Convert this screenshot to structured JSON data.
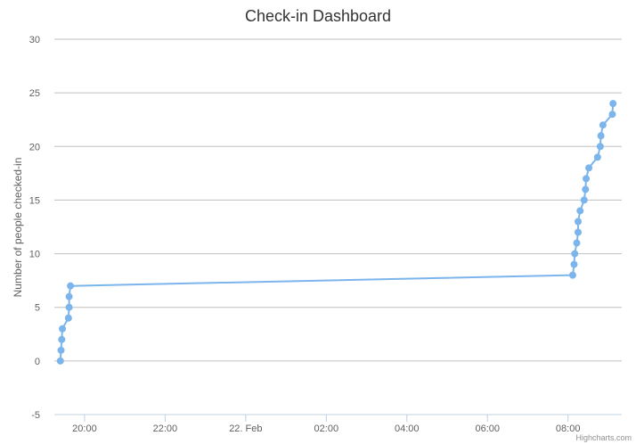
{
  "chart_data": {
    "type": "line",
    "title": "Check-in Dashboard",
    "xlabel": "",
    "ylabel": "Number of people checked-in",
    "x_type": "datetime",
    "xlim": [
      "2020-02-21T19:15",
      "2020-02-22T09:20"
    ],
    "ylim": [
      -5,
      30
    ],
    "y_ticks": [
      -5,
      0,
      5,
      10,
      15,
      20,
      25,
      30
    ],
    "x_ticks": [
      {
        "t": "2020-02-21T20:00",
        "label": "20:00"
      },
      {
        "t": "2020-02-21T22:00",
        "label": "22:00"
      },
      {
        "t": "2020-02-22T00:00",
        "label": "22. Feb"
      },
      {
        "t": "2020-02-22T02:00",
        "label": "02:00"
      },
      {
        "t": "2020-02-22T04:00",
        "label": "04:00"
      },
      {
        "t": "2020-02-22T06:00",
        "label": "06:00"
      },
      {
        "t": "2020-02-22T08:00",
        "label": "08:00"
      }
    ],
    "grid": true,
    "legend": false,
    "series_color": "#7cb5ec",
    "grid_color": "#c0c0c0",
    "series": [
      {
        "points": [
          {
            "x": "2020-02-21T19:24",
            "y": 0
          },
          {
            "x": "2020-02-21T19:25",
            "y": 1
          },
          {
            "x": "2020-02-21T19:26",
            "y": 2
          },
          {
            "x": "2020-02-21T19:27",
            "y": 3
          },
          {
            "x": "2020-02-21T19:36",
            "y": 4
          },
          {
            "x": "2020-02-21T19:37",
            "y": 5
          },
          {
            "x": "2020-02-21T19:37",
            "y": 6
          },
          {
            "x": "2020-02-21T19:39",
            "y": 7
          },
          {
            "x": "2020-02-22T08:07",
            "y": 8
          },
          {
            "x": "2020-02-22T08:09",
            "y": 9
          },
          {
            "x": "2020-02-22T08:10",
            "y": 10
          },
          {
            "x": "2020-02-22T08:13",
            "y": 11
          },
          {
            "x": "2020-02-22T08:15",
            "y": 12
          },
          {
            "x": "2020-02-22T08:15",
            "y": 13
          },
          {
            "x": "2020-02-22T08:18",
            "y": 14
          },
          {
            "x": "2020-02-22T08:24",
            "y": 15
          },
          {
            "x": "2020-02-22T08:26",
            "y": 16
          },
          {
            "x": "2020-02-22T08:27",
            "y": 17
          },
          {
            "x": "2020-02-22T08:31",
            "y": 18
          },
          {
            "x": "2020-02-22T08:44",
            "y": 19
          },
          {
            "x": "2020-02-22T08:48",
            "y": 20
          },
          {
            "x": "2020-02-22T08:49",
            "y": 21
          },
          {
            "x": "2020-02-22T08:52",
            "y": 22
          },
          {
            "x": "2020-02-22T09:06",
            "y": 23
          },
          {
            "x": "2020-02-22T09:07",
            "y": 24
          }
        ]
      }
    ]
  },
  "credit": "Highcharts.com"
}
